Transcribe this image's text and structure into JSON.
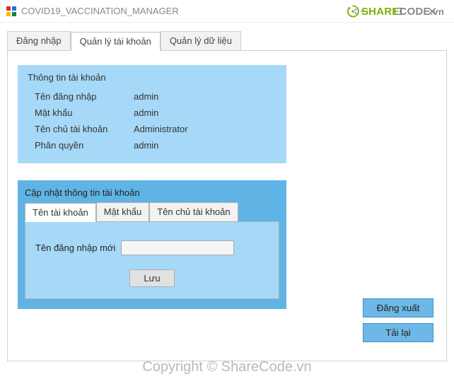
{
  "window": {
    "title": "COVID19_VACCINATION_MANAGER"
  },
  "sharecode": {
    "prefix": "SHARE",
    "suffix": "CODE",
    "tld": ".vn"
  },
  "tabs": {
    "login": "Đăng nhập",
    "accounts": "Quản lý tài khoản",
    "data": "Quản lý dữ liệu"
  },
  "account_info": {
    "title": "Thông tin tài khoản",
    "rows": {
      "username_label": "Tên đăng nhập",
      "username_value": "admin",
      "password_label": "Mật khẩu",
      "password_value": "admin",
      "owner_label": "Tên chủ tài khoản",
      "owner_value": "Administrator",
      "role_label": "Phân quyền",
      "role_value": "admin"
    }
  },
  "update_panel": {
    "title": "Cập nhật thông tin tài khoản",
    "tabs": {
      "username": "Tên tài khoản",
      "password": "Mật khẩu",
      "owner": "Tên chủ tài khoản"
    },
    "field_label": "Tên đăng nhập mới",
    "field_value": "",
    "save": "Lưu"
  },
  "side": {
    "logout": "Đăng xuất",
    "reload": "Tải lại"
  },
  "watermark": "Copyright © ShareCode.vn"
}
